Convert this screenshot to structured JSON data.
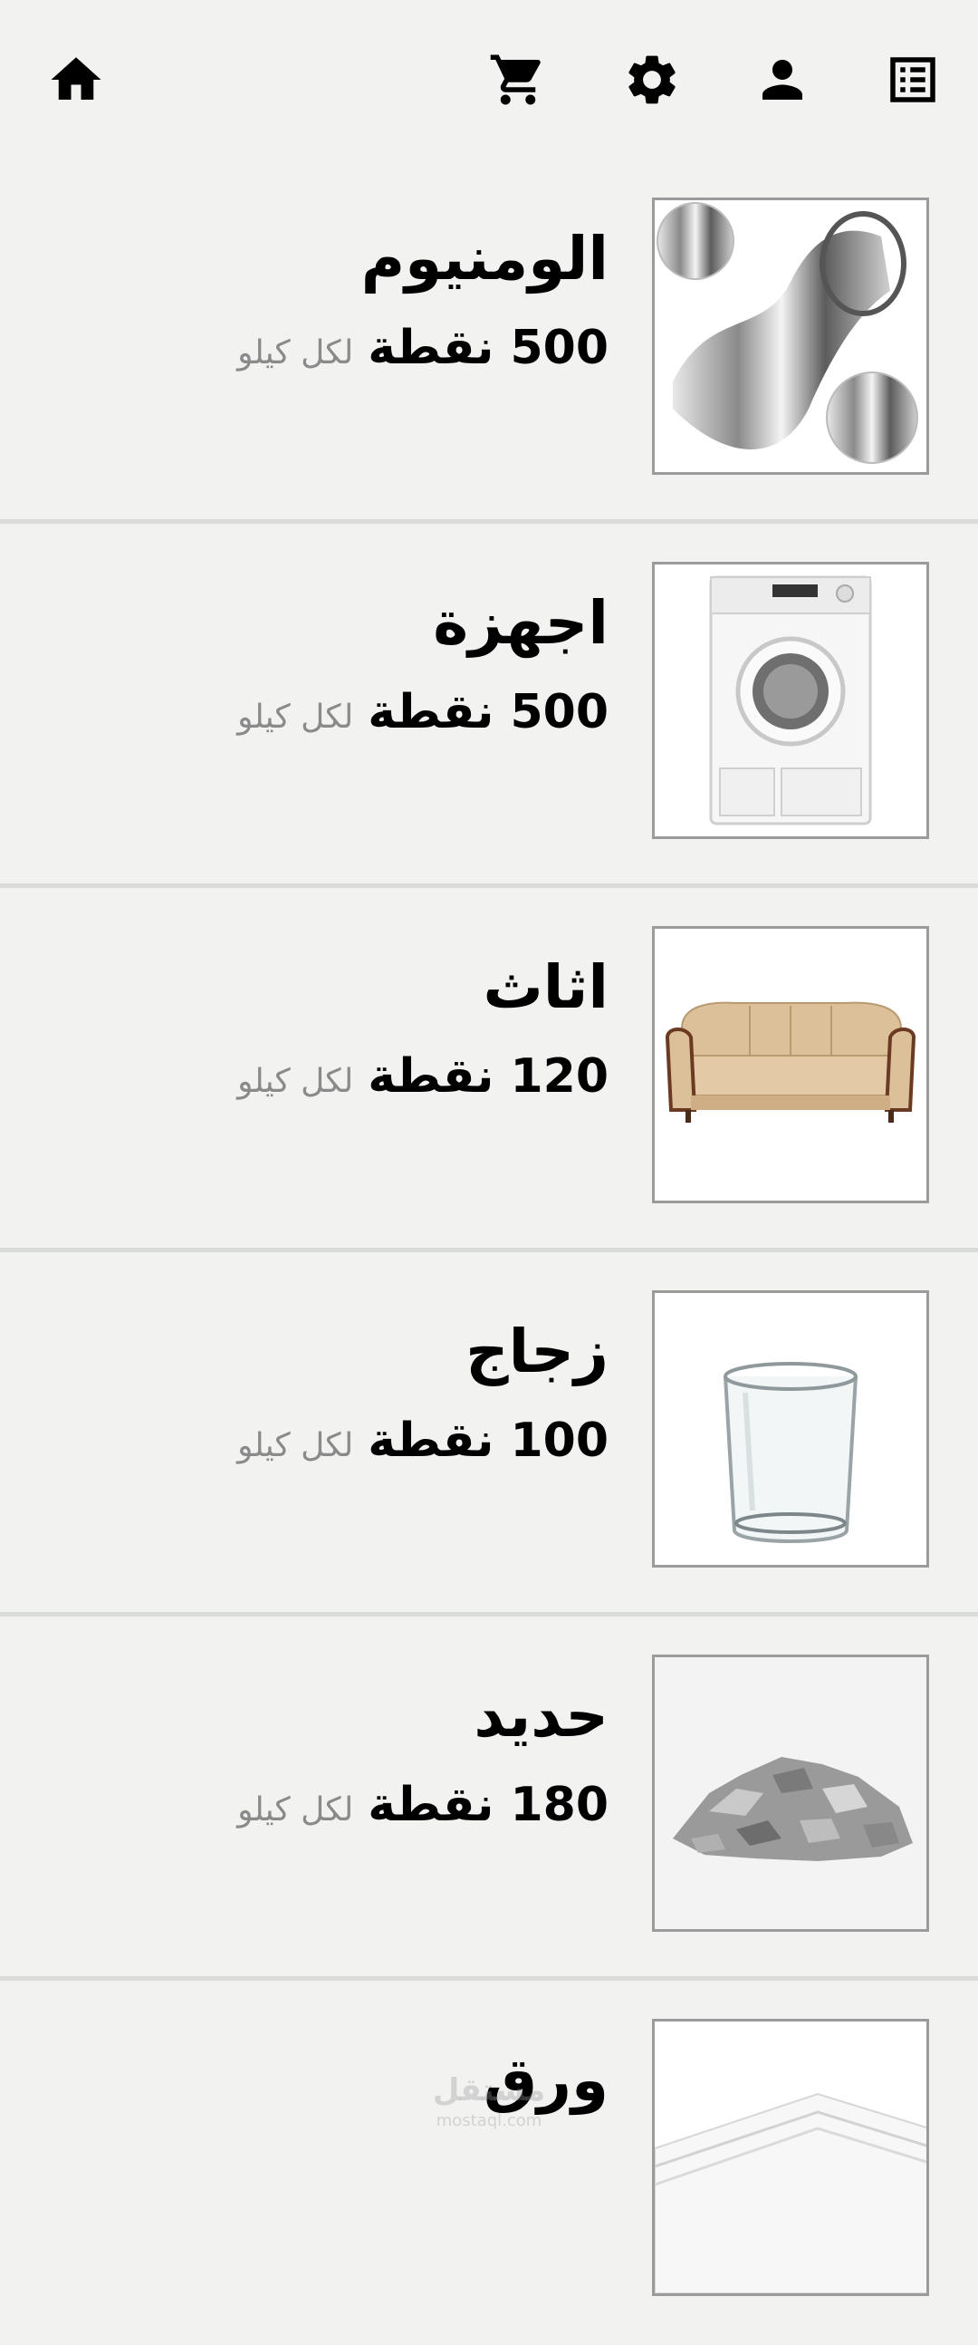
{
  "topbar": {
    "icons": {
      "home": "home-icon",
      "cart": "shopping-cart-icon",
      "settings": "gear-icon",
      "profile": "person-icon",
      "list": "list-icon"
    }
  },
  "items": [
    {
      "title": "الومنيوم",
      "price": "500 نقطة",
      "unit": "لكل كيلو",
      "image": "aluminum-foil-image"
    },
    {
      "title": "اجهزة",
      "price": "500 نقطة",
      "unit": "لكل كيلو",
      "image": "washing-machine-image"
    },
    {
      "title": "اثاث",
      "price": "120 نقطة",
      "unit": "لكل كيلو",
      "image": "sofa-image"
    },
    {
      "title": "زجاج",
      "price": "100 نقطة",
      "unit": "لكل كيلو",
      "image": "glass-cup-image"
    },
    {
      "title": "حديد",
      "price": "180 نقطة",
      "unit": "لكل كيلو",
      "image": "iron-pieces-image"
    },
    {
      "title": "ورق",
      "price": "",
      "unit": "",
      "image": "paper-sheets-image"
    }
  ],
  "watermark": {
    "text": "مستقل",
    "sub": "mostaql.com"
  }
}
